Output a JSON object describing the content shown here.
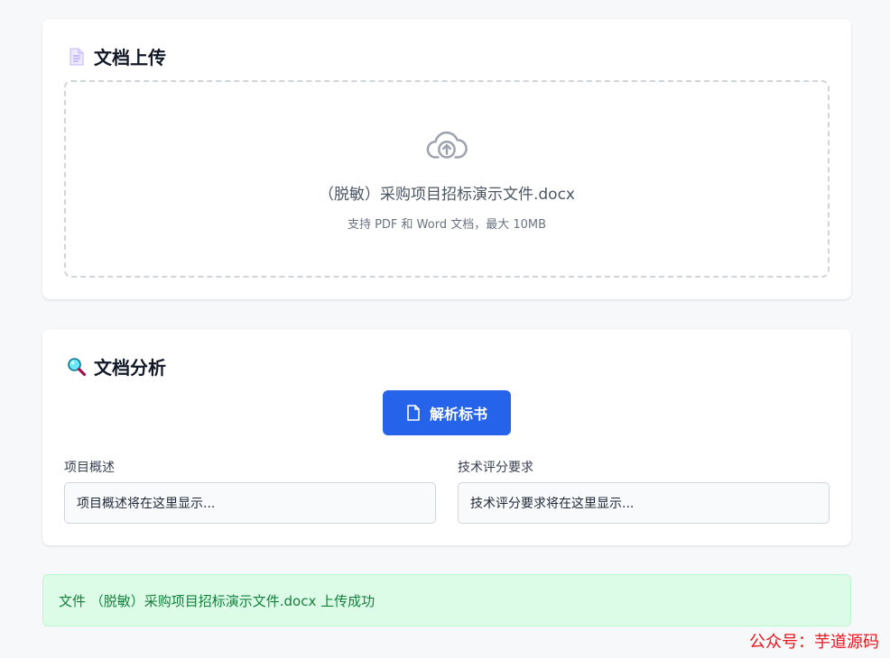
{
  "upload": {
    "title": "文档上传",
    "icon": "document-icon",
    "filename": "（脱敏）采购项目招标演示文件.docx",
    "hint": "支持 PDF 和 Word 文档，最大 10MB"
  },
  "analysis": {
    "title": "文档分析",
    "icon": "magnifier-icon",
    "parse_button": "解析标书",
    "overview_label": "项目概述",
    "overview_value": "项目概述将在这里显示...",
    "tech_label": "技术评分要求",
    "tech_value": "技术评分要求将在这里显示..."
  },
  "alert": {
    "message": "文件 （脱敏）采购项目招标演示文件.docx 上传成功"
  },
  "watermark": "公众号：芋道源码",
  "colors": {
    "primary": "#2563eb",
    "success_bg": "#dcfce7",
    "success_text": "#15803d",
    "watermark": "#e8161c"
  }
}
